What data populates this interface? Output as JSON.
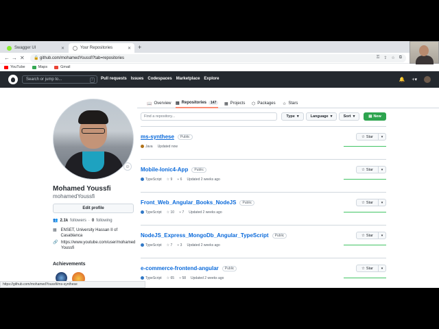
{
  "browser": {
    "tabs": [
      {
        "title": "Swagger UI",
        "favicon_color": "#85ea2d",
        "active": false
      },
      {
        "title": "Your Repositories",
        "favicon_color": "#ffffff",
        "active": true
      }
    ],
    "new_tab": "+",
    "url": "github.com/mohamedYoussfi?tab=repositories",
    "bookmarks": [
      {
        "label": "YouTube",
        "icon_color": "#ff0000"
      },
      {
        "label": "Maps",
        "icon_color": "#34a853"
      },
      {
        "label": "Gmail",
        "icon_color": "#ea4335"
      }
    ],
    "status_url": "https://github.com/mohamedYoussfi/ms-synthese"
  },
  "header": {
    "search_placeholder": "Search or jump to...",
    "slash": "/",
    "nav": [
      "Pull requests",
      "Issues",
      "Codespaces",
      "Marketplace",
      "Explore"
    ],
    "right_icons": [
      "bell-icon",
      "plus-icon",
      "avatar"
    ]
  },
  "profile": {
    "name": "Mohamed Youssfi",
    "login": "mohamedYoussfi",
    "edit_label": "Edit profile",
    "followers_count": "2.1k",
    "followers_label": "followers",
    "separator": "·",
    "following_count": "0",
    "following_label": "following",
    "org": "ENSET, University Hassan II of Casablanca",
    "link_line1": "https://www.youtube.com/user/mohamed",
    "link_line2": "Youssfi",
    "achievements_title": "Achievements"
  },
  "tabs": [
    {
      "label": "Overview",
      "icon": "book-icon"
    },
    {
      "label": "Repositories",
      "icon": "repo-icon",
      "count": "147"
    },
    {
      "label": "Projects",
      "icon": "table-icon"
    },
    {
      "label": "Packages",
      "icon": "package-icon"
    },
    {
      "label": "Stars",
      "icon": "star-icon"
    }
  ],
  "filters": {
    "search_placeholder": "Find a repository...",
    "type_label": "Type",
    "language_label": "Language",
    "sort_label": "Sort",
    "new_label": "New"
  },
  "repos": [
    {
      "name": "ms-synthese",
      "visibility": "Public",
      "language": "Java",
      "language_color": "#b07219",
      "stars": "",
      "forks": "",
      "updated": "Updated now"
    },
    {
      "name": "Mobile-Ionic4-App",
      "visibility": "Public",
      "language": "TypeScript",
      "language_color": "#3178c6",
      "stars": "9",
      "forks": "6",
      "updated": "Updated 2 weeks ago"
    },
    {
      "name": "Front_Web_Angular_Books_NodeJS",
      "visibility": "Public",
      "language": "TypeScript",
      "language_color": "#3178c6",
      "stars": "10",
      "forks": "7",
      "updated": "Updated 2 weeks ago"
    },
    {
      "name": "NodeJS_Express_MongoDb_Angular_TypeScript",
      "visibility": "Public",
      "language": "TypeScript",
      "language_color": "#3178c6",
      "stars": "7",
      "forks": "3",
      "updated": "Updated 2 weeks ago"
    },
    {
      "name": "e-commerce-frontend-angular",
      "visibility": "Public",
      "language": "TypeScript",
      "language_color": "#3178c6",
      "stars": "65",
      "forks": "58",
      "updated": "Updated 2 weeks ago"
    }
  ],
  "star_label": "Star"
}
